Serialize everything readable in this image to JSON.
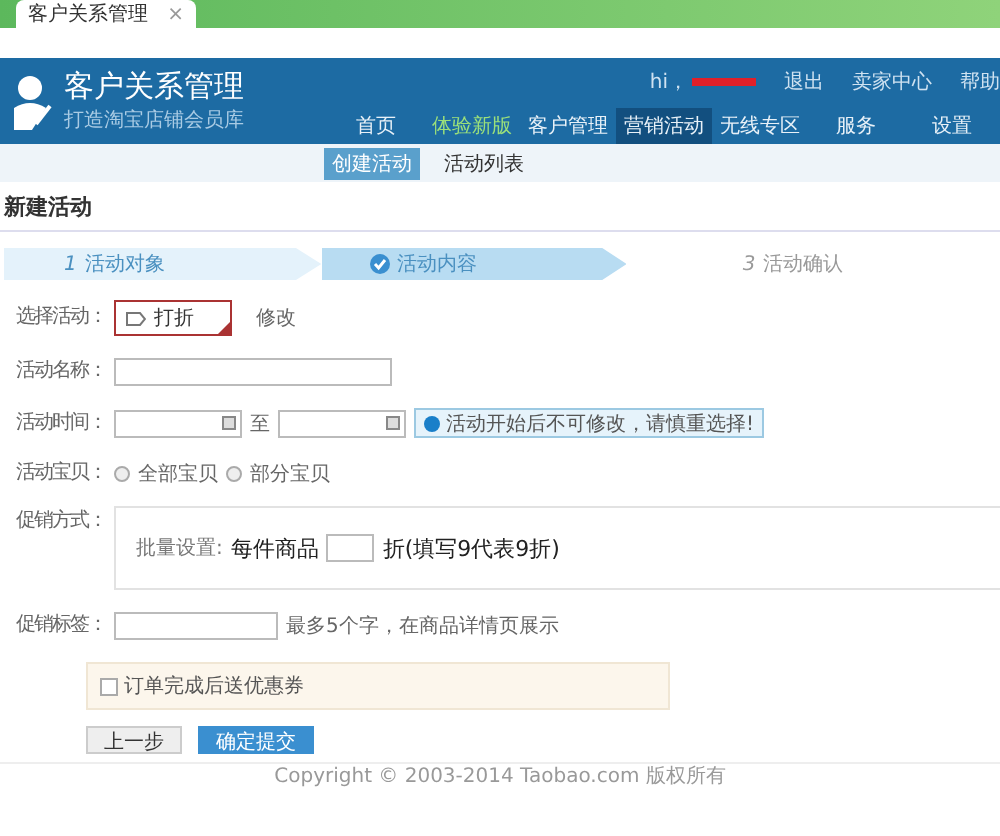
{
  "browser_tab": {
    "title": "客户关系管理",
    "close": "×"
  },
  "header": {
    "app_title": "客户关系管理",
    "subtitle": "打造淘宝店铺会员库",
    "greeting": "hi，",
    "links": [
      "退出",
      "卖家中心",
      "帮助"
    ],
    "nav": [
      {
        "label": "首页",
        "selected": false,
        "highlight": false
      },
      {
        "label": "体验新版",
        "selected": false,
        "highlight": true
      },
      {
        "label": "客户管理",
        "selected": false,
        "highlight": false
      },
      {
        "label": "营销活动",
        "selected": true,
        "highlight": false
      },
      {
        "label": "无线专区",
        "selected": false,
        "highlight": false
      },
      {
        "label": "服务",
        "selected": false,
        "highlight": false
      },
      {
        "label": "设置",
        "selected": false,
        "highlight": false
      }
    ]
  },
  "sub_nav": [
    {
      "label": "创建活动",
      "selected": true
    },
    {
      "label": "活动列表",
      "selected": false
    }
  ],
  "page_title": "新建活动",
  "steps": [
    {
      "number": "1",
      "label": "活动对象",
      "kind": "done"
    },
    {
      "label": "活动内容",
      "kind": "current"
    },
    {
      "number": "3",
      "label": "活动确认",
      "kind": "todo"
    }
  ],
  "form": {
    "activity": {
      "label": "选择活动：",
      "value": "打折",
      "change": "修改"
    },
    "name": {
      "label": "活动名称："
    },
    "time": {
      "label": "活动时间：",
      "to": "至",
      "notice": "活动开始后不可修改，请慎重选择!"
    },
    "items": {
      "label": "活动宝贝：",
      "options": [
        {
          "label": "全部宝贝",
          "selected": false
        },
        {
          "label": "部分宝贝",
          "selected": false
        }
      ]
    },
    "promo": {
      "label": "促销方式：",
      "batch": "批量设置:",
      "per_item": "每件商品",
      "unit": "折(填写9代表9折)"
    },
    "tag": {
      "label": "促销标签：",
      "hint": "最多5个字，在商品详情页展示"
    },
    "coupon": {
      "label": "订单完成后送优惠券",
      "checked": false
    }
  },
  "buttons": {
    "back": "上一步",
    "submit": "确定提交"
  },
  "footer": "Copyright © 2003-2014 Taobao.com 版权所有"
}
